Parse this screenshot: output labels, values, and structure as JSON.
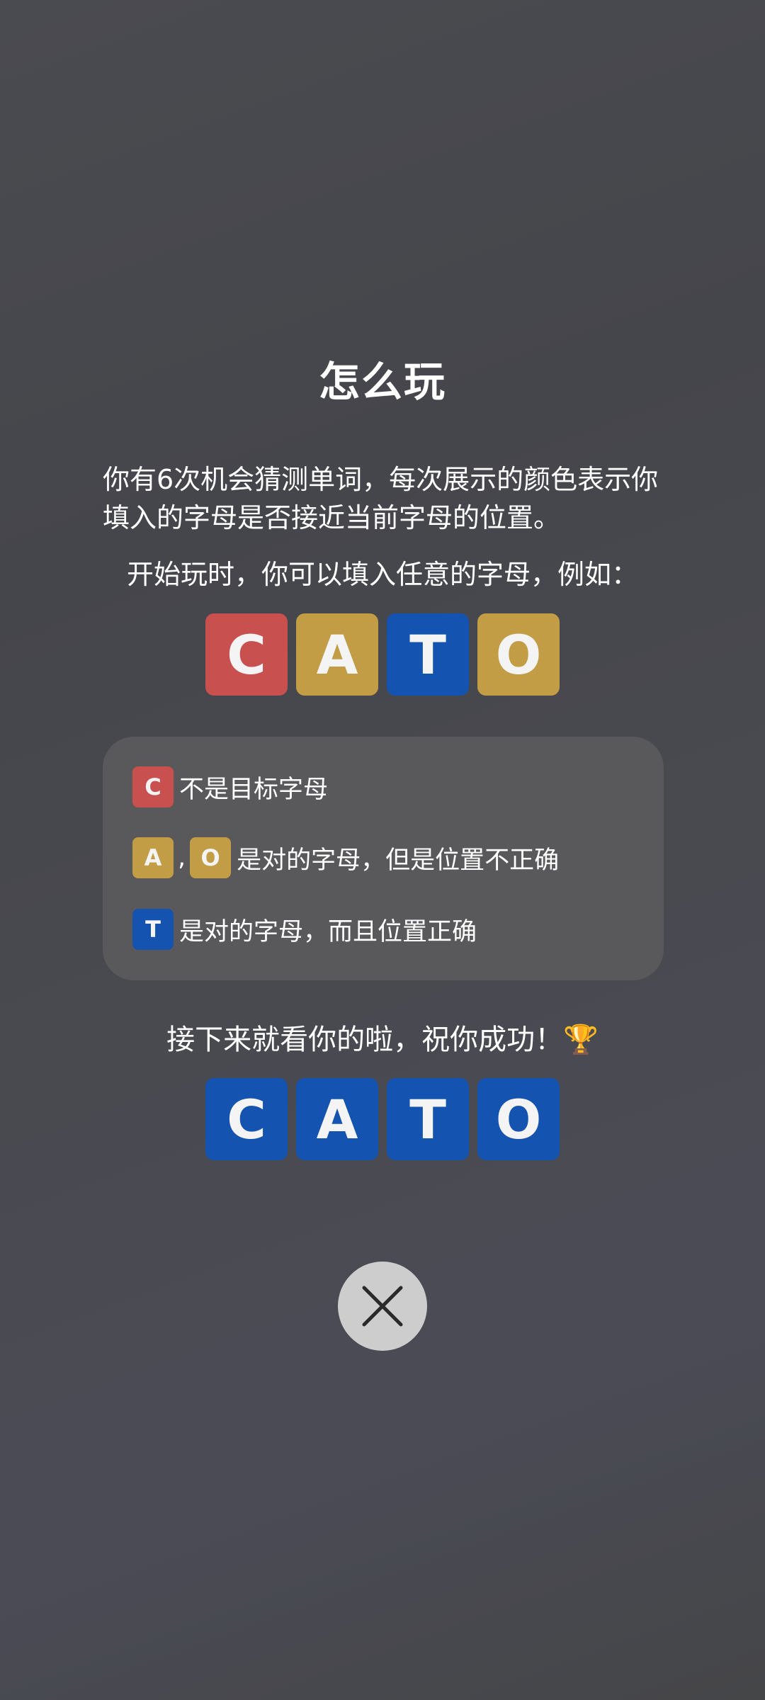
{
  "title": "怎么玩",
  "intro": "你有6次机会猜测单词，每次展示的颜色表示你填入的字母是否接近当前字母的位置。",
  "example_caption": "开始玩时，你可以填入任意的字母，例如：",
  "colors": {
    "absent": "#c8504e",
    "present": "#c29d46",
    "correct": "#1553b0",
    "legend_bg": "#59595b",
    "close_bg": "#cdcdcd"
  },
  "example_tiles": [
    {
      "letter": "C",
      "state": "absent"
    },
    {
      "letter": "A",
      "state": "present"
    },
    {
      "letter": "T",
      "state": "correct"
    },
    {
      "letter": "O",
      "state": "present"
    }
  ],
  "legend": {
    "absent": {
      "letter": "C",
      "text": "不是目标字母"
    },
    "present": {
      "letters": [
        "A",
        "O"
      ],
      "separator": ",",
      "text": "是对的字母，但是位置不正确"
    },
    "correct": {
      "letter": "T",
      "text": "是对的字母，而且位置正确"
    }
  },
  "good_luck": "接下来就看你的啦，祝你成功！🏆",
  "final_tiles": [
    {
      "letter": "C",
      "state": "correct"
    },
    {
      "letter": "A",
      "state": "correct"
    },
    {
      "letter": "T",
      "state": "correct"
    },
    {
      "letter": "O",
      "state": "correct"
    }
  ],
  "close_icon": "close-icon"
}
